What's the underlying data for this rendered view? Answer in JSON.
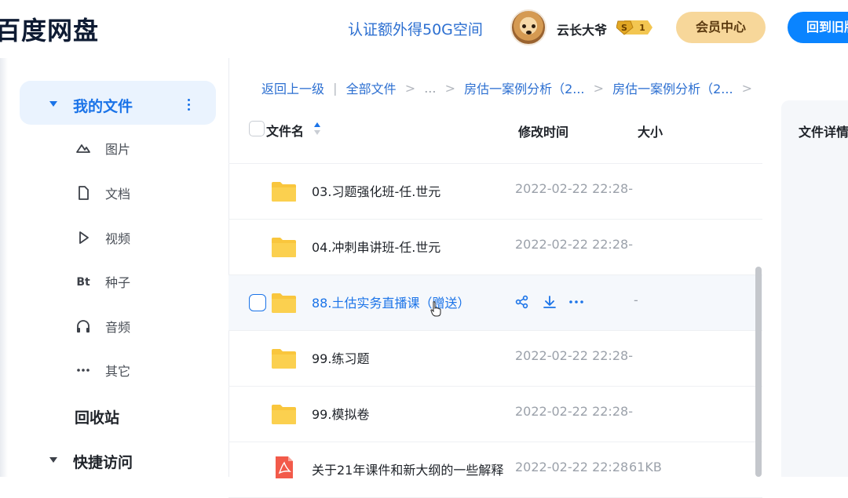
{
  "app": {
    "logo": "百度网盘"
  },
  "header": {
    "promo": "认证额外得50G空间",
    "username": "云长大爷",
    "level_badge": "1",
    "vip_button": "会员中心",
    "old_version_button": "回到旧版"
  },
  "sidebar": {
    "my_files": "我的文件",
    "items": [
      {
        "icon": "image-icon",
        "label": "图片"
      },
      {
        "icon": "document-icon",
        "label": "文档"
      },
      {
        "icon": "video-icon",
        "label": "视频"
      },
      {
        "icon": "torrent-icon",
        "label": "种子"
      },
      {
        "icon": "headphones-icon",
        "label": "音频"
      },
      {
        "icon": "more-icon",
        "label": "其它"
      }
    ],
    "trash": "回收站",
    "quick_access": "快捷访问"
  },
  "breadcrumb": {
    "back": "返回上一级",
    "all_files": "全部文件",
    "ellipsis": "...",
    "level1": "房估一案例分析（2...",
    "level2": "房估一案例分析（2..."
  },
  "table": {
    "columns": {
      "name": "文件名",
      "modified": "修改时间",
      "size": "大小"
    },
    "rows": [
      {
        "type": "folder",
        "name": "03.习题强化班-任.世元",
        "modified": "2022-02-22 22:28",
        "size": "-"
      },
      {
        "type": "folder",
        "name": "04.冲刺串讲班-任.世元",
        "modified": "2022-02-22 22:28",
        "size": "-"
      },
      {
        "type": "folder",
        "name": "88.土估实务直播课（赠送）",
        "modified": "",
        "size": "-",
        "hover": true
      },
      {
        "type": "folder",
        "name": "99.练习题",
        "modified": "2022-02-22 22:28",
        "size": "-"
      },
      {
        "type": "folder",
        "name": "99.模拟卷",
        "modified": "2022-02-22 22:28",
        "size": "-"
      },
      {
        "type": "pdf",
        "name": "关于21年课件和新大纲的一些解释",
        "modified": "2022-02-22 22:28",
        "size": "61KB"
      }
    ]
  },
  "detail_panel": {
    "title": "文件详情"
  },
  "colors": {
    "accent": "#1a73e8",
    "folder": "#f9c63d",
    "vip": "#f7d79a",
    "primary_button": "#0a84ff"
  }
}
